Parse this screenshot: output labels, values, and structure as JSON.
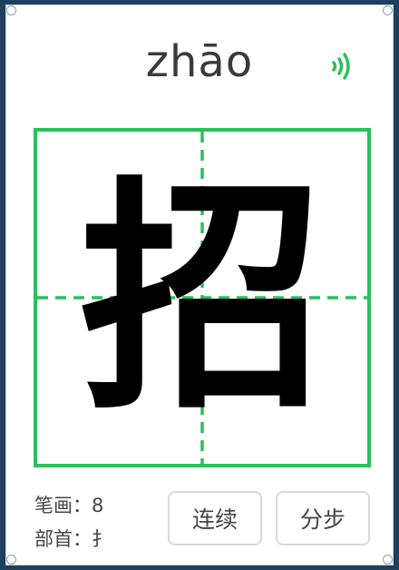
{
  "character": {
    "pinyin": "zhāo",
    "hanzi": "招"
  },
  "info": {
    "strokes_label": "笔画：8",
    "radical_label": "部首：扌"
  },
  "buttons": {
    "continuous": "连续",
    "step": "分步"
  },
  "icons": {
    "sound": "sound-wave-icon"
  },
  "colors": {
    "accent": "#2bbf5e",
    "frame": "#1e3f5e",
    "text": "#444444",
    "character": "#000000"
  }
}
